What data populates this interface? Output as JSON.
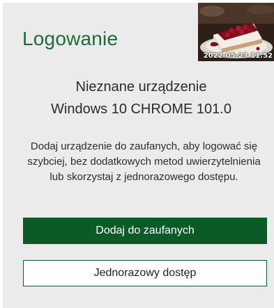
{
  "login": {
    "title": "Logowanie",
    "thumbnail": {
      "description_icon": "cheesecake-photo",
      "timestamp": "2022-05-23 11:52"
    },
    "device": {
      "line1": "Nieznane urządzenie",
      "line2": "Windows 10 CHROME 101.0"
    },
    "description": "Dodaj urządzenie do zaufanych, aby logować się szybciej, bez dodatkowych metod uwierzytelnienia lub skorzystaj z jednorazowego dostępu.",
    "buttons": {
      "trust_label": "Dodaj do zaufanych",
      "one_time_label": "Jednorazowy dostęp"
    },
    "colors": {
      "accent": "#0b5a28",
      "title": "#1e6b36",
      "card_bg": "#ebebeb"
    }
  }
}
